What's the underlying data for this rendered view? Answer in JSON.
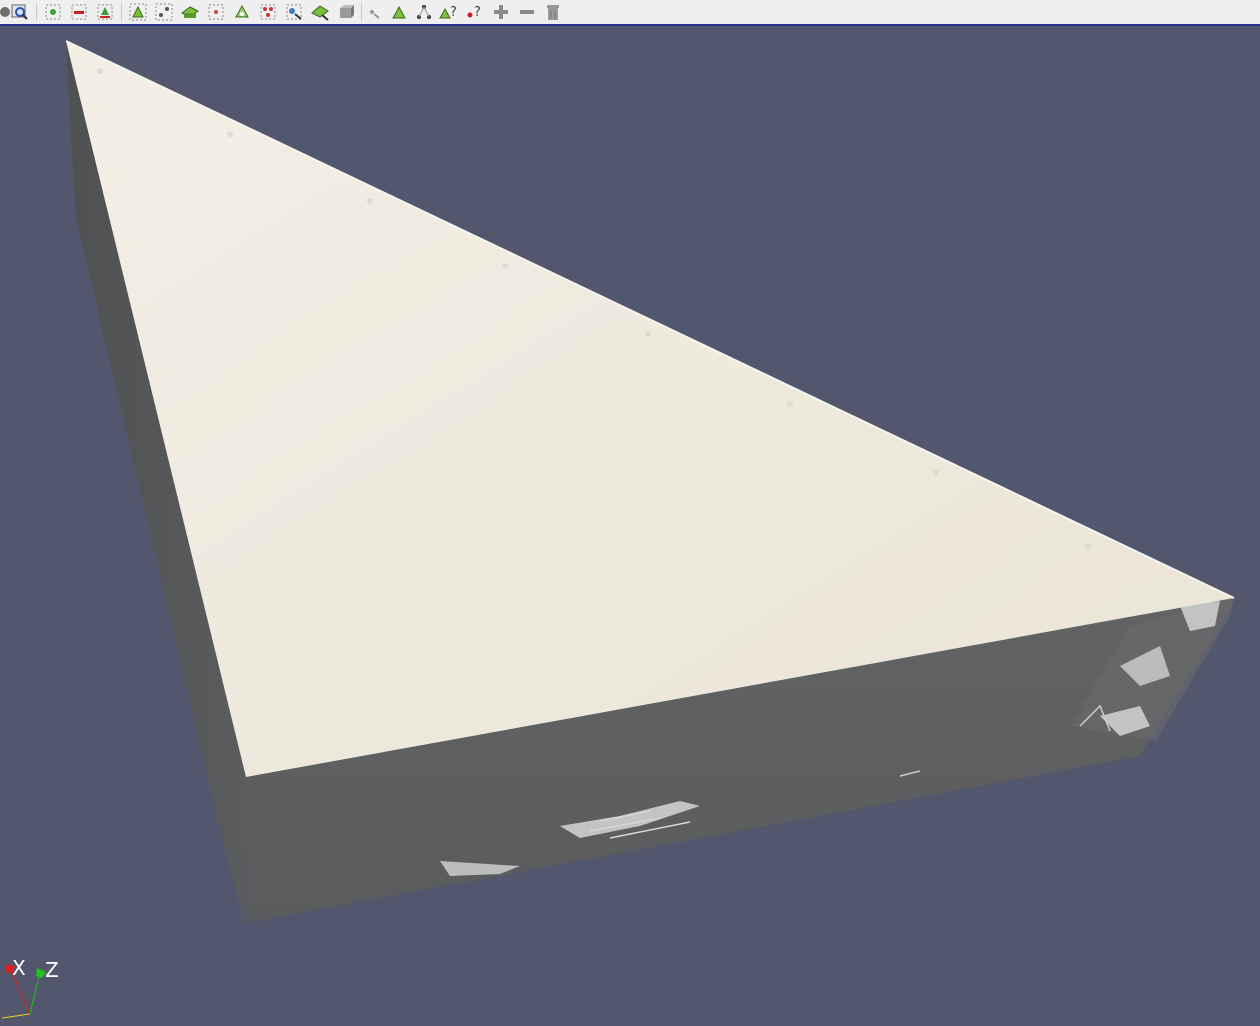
{
  "toolbar": {
    "buttons": [
      {
        "name": "zoom-to-box-button",
        "icon": "zoom-box-icon"
      },
      {
        "name": "select-cells-on-button",
        "icon": "select-cells-on-icon"
      },
      {
        "name": "select-points-on-button",
        "icon": "select-points-on-icon"
      },
      {
        "name": "select-cells-with-polygon-button",
        "icon": "select-polygon-icon"
      },
      {
        "name": "select-block-button",
        "icon": "select-block-icon"
      },
      {
        "name": "interactive-select-cells-button",
        "icon": "interactive-select-cells-icon"
      },
      {
        "name": "interactive-select-points-button",
        "icon": "interactive-select-points-icon"
      },
      {
        "name": "hover-points-button",
        "icon": "hover-points-icon"
      },
      {
        "name": "hover-cells-button",
        "icon": "hover-cells-icon"
      },
      {
        "name": "grow-selection-button",
        "icon": "plus-icon"
      },
      {
        "name": "shrink-selection-button",
        "icon": "minus-icon"
      },
      {
        "name": "clear-selection-button",
        "icon": "trash-icon"
      }
    ]
  },
  "axes": {
    "x_label": "X",
    "z_label": "Z",
    "colors": {
      "x": "#d42020",
      "y": "#e8d020",
      "z": "#22c022"
    }
  },
  "viewport": {
    "background": "#52576e",
    "surface_color": "#ece7da",
    "side_color": "#5e5f61"
  }
}
